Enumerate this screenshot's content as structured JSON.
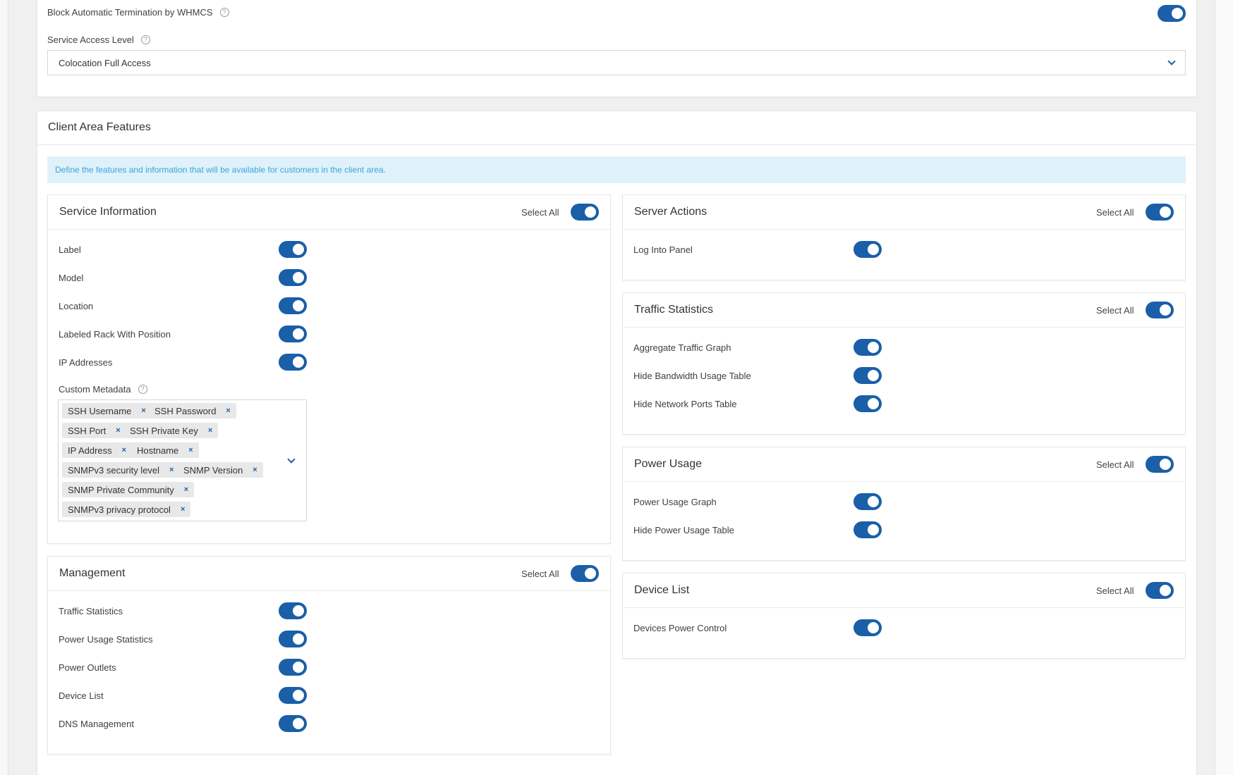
{
  "top_settings": {
    "block_termination_label": "Block Automatic Termination by WHMCS",
    "service_access_label": "Service Access Level",
    "service_access_value": "Colocation Full Access"
  },
  "client_area": {
    "title": "Client Area Features",
    "info": "Define the features and information that will be available for customers in the client area."
  },
  "select_all_label": "Select All",
  "service_information": {
    "title": "Service Information",
    "items": [
      "Label",
      "Model",
      "Location",
      "Labeled Rack With Position",
      "IP Addresses"
    ],
    "custom_metadata_label": "Custom Metadata",
    "tags": [
      "SSH Username",
      "SSH Password",
      "SSH Port",
      "SSH Private Key",
      "IP Address",
      "Hostname",
      "SNMPv3 security level",
      "SNMP Version",
      "SNMP Private Community",
      "SNMPv3 privacy protocol"
    ]
  },
  "management": {
    "title": "Management",
    "items": [
      "Traffic Statistics",
      "Power Usage Statistics",
      "Power Outlets",
      "Device List",
      "DNS Management"
    ]
  },
  "server_actions": {
    "title": "Server Actions",
    "items": [
      "Log Into Panel"
    ]
  },
  "traffic_statistics": {
    "title": "Traffic Statistics",
    "items": [
      "Aggregate Traffic Graph",
      "Hide Bandwidth Usage Table",
      "Hide Network Ports Table"
    ]
  },
  "power_usage": {
    "title": "Power Usage",
    "items": [
      "Power Usage Graph",
      "Hide Power Usage Table"
    ]
  },
  "device_list": {
    "title": "Device List",
    "items": [
      "Devices Power Control"
    ]
  },
  "colors": {
    "accent": "#1a5fa8",
    "info_bg": "#dff1fb",
    "info_text": "#3aa4d8"
  }
}
